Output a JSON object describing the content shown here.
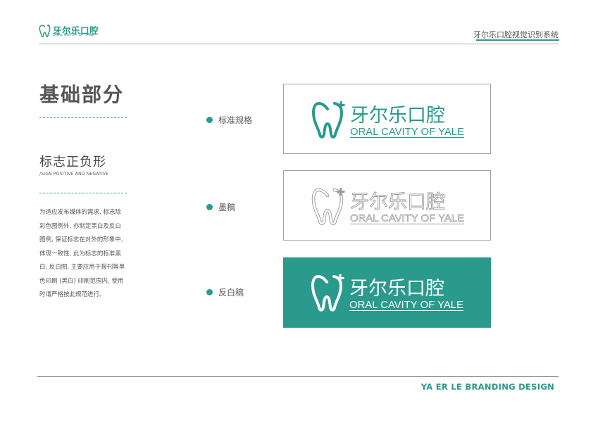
{
  "header": {
    "logo_cn": "牙尔乐口腔",
    "logo_en": "ORAL CAVITY OF YALE",
    "system_title": "牙尔乐口腔视觉识别系统"
  },
  "section": {
    "title": "基础部分",
    "subtitle": "标志正负形",
    "subtitle_en": "/SIGN POSITIVE AND NEGATIVE",
    "description_lines": [
      "为适应发布媒体的需求, 标志除",
      "彩色图例外, 亦制定黑白及反白",
      "图例, 保证标志在对外的形象中,",
      "体现一致性, 此为标志的标准黑",
      "白, 反白图, 主要应用于报刊等单",
      "色印刷 (黑白) 印刷范围内, 使用",
      "时请严格按此规范进行。"
    ]
  },
  "variants": [
    {
      "label": "标准规格",
      "logo_cn": "牙尔乐口腔",
      "logo_en": "ORAL CAVITY OF YALE"
    },
    {
      "label": "墨稿",
      "logo_cn": "牙尔乐口腔",
      "logo_en": "ORAL CAVITY OF YALE"
    },
    {
      "label": "反白稿",
      "logo_cn": "牙尔乐口腔",
      "logo_en": "ORAL CAVITY OF YALE"
    }
  ],
  "footer": {
    "brand_text": "YA ER LE BRANDING DESIGN"
  },
  "colors": {
    "brand_teal": "#2a9a8c",
    "text_gray": "#595757",
    "outline_gray": "#9a9a9a"
  }
}
